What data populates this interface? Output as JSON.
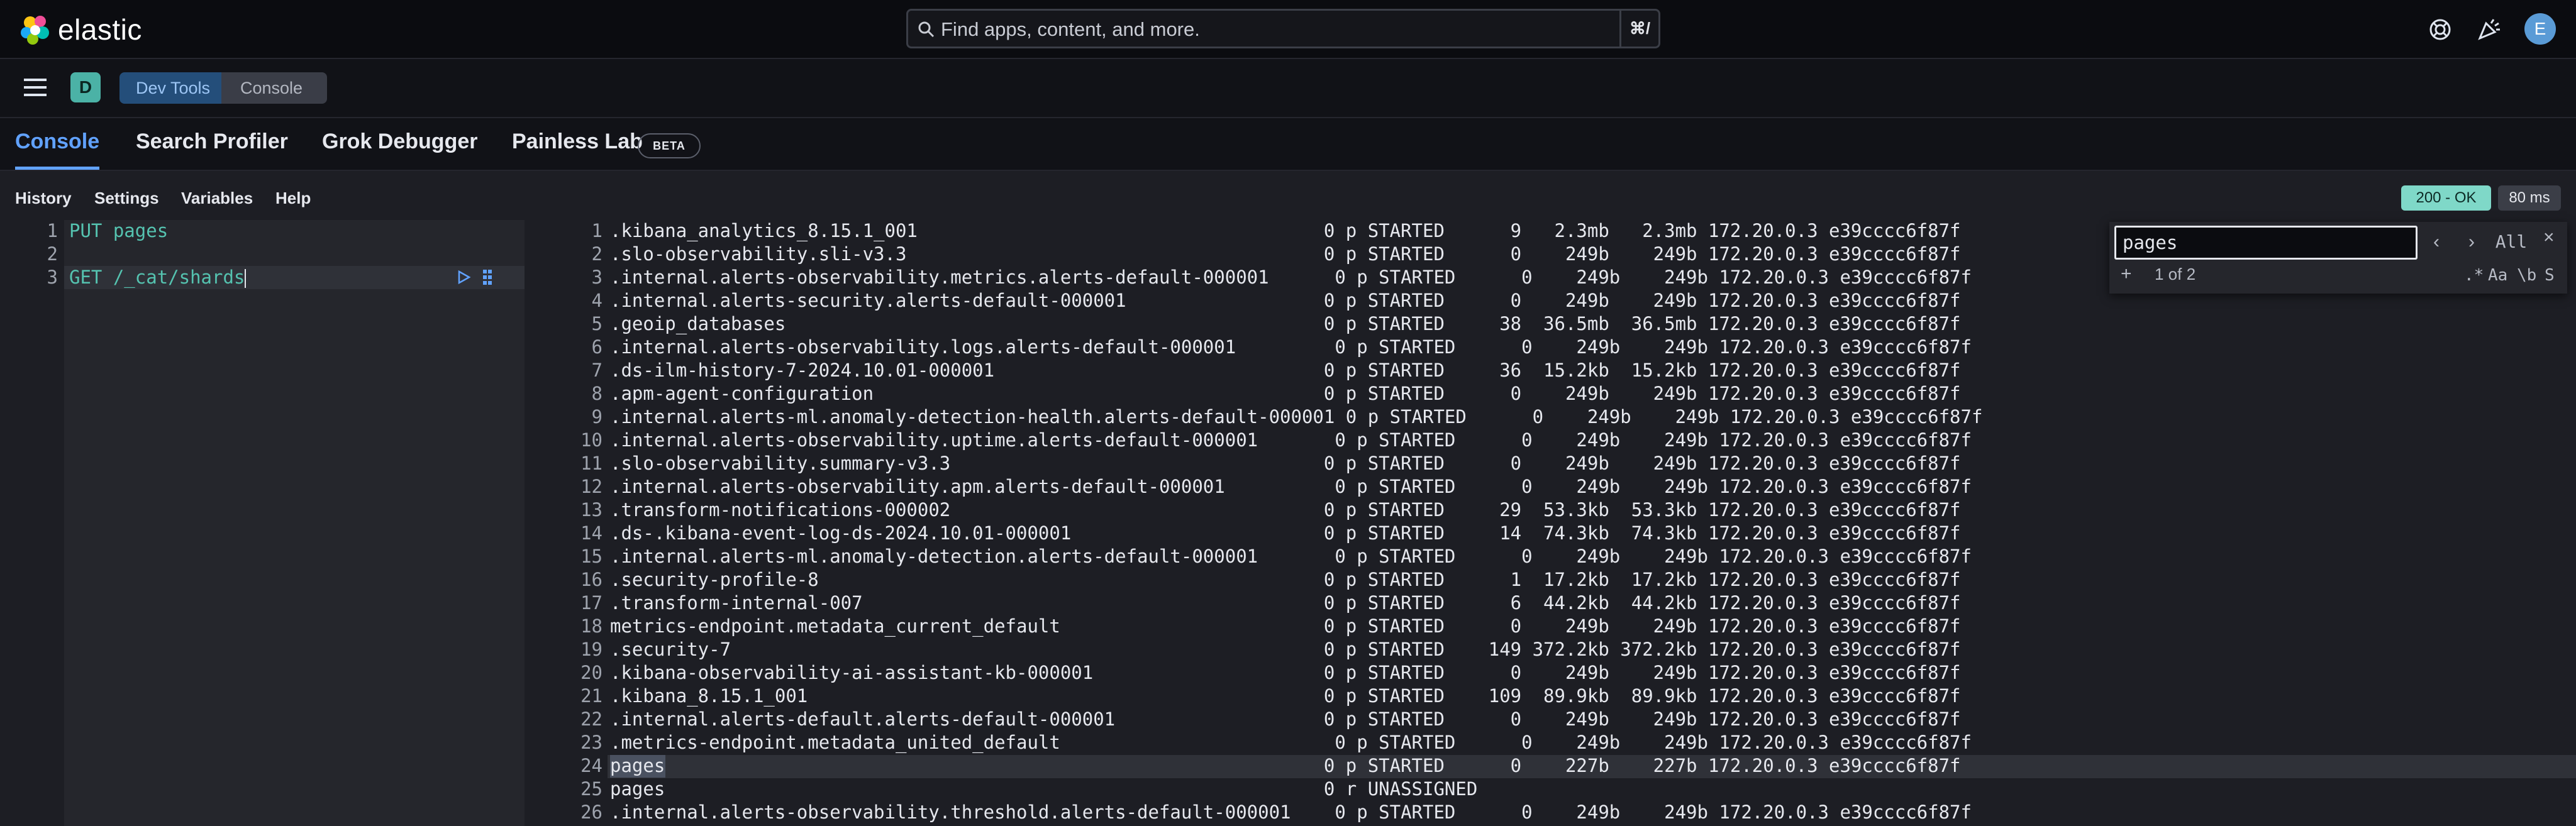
{
  "header": {
    "brand": "elastic",
    "search_placeholder": "Find apps, content, and more.",
    "search_shortcut": "⌘/",
    "avatar_initial": "E"
  },
  "breadcrumb": {
    "space_initial": "D",
    "items": [
      "Dev Tools",
      "Console"
    ]
  },
  "tabs": [
    {
      "label": "Console",
      "active": true
    },
    {
      "label": "Search Profiler"
    },
    {
      "label": "Grok Debugger"
    },
    {
      "label": "Painless Lab"
    }
  ],
  "beta_badge": "BETA",
  "toolbar": {
    "items": [
      "History",
      "Settings",
      "Variables",
      "Help"
    ],
    "status": "200 - OK",
    "time": "80 ms"
  },
  "request": {
    "lines": [
      {
        "n": "1",
        "method": "PUT",
        "text": " pages"
      },
      {
        "n": "2",
        "method": "",
        "text": ""
      },
      {
        "n": "3",
        "method": "GET",
        "text": " /_cat/shards"
      }
    ]
  },
  "response": {
    "highlighted_line": "24",
    "lines": [
      {
        "n": "1",
        "text": ".kibana_analytics_8.15.1_001                                     0 p STARTED      9   2.3mb   2.3mb 172.20.0.3 e39cccc6f87f"
      },
      {
        "n": "2",
        "text": ".slo-observability.sli-v3.3                                      0 p STARTED      0    249b    249b 172.20.0.3 e39cccc6f87f"
      },
      {
        "n": "3",
        "text": ".internal.alerts-observability.metrics.alerts-default-000001      0 p STARTED      0    249b    249b 172.20.0.3 e39cccc6f87f"
      },
      {
        "n": "4",
        "text": ".internal.alerts-security.alerts-default-000001                  0 p STARTED      0    249b    249b 172.20.0.3 e39cccc6f87f"
      },
      {
        "n": "5",
        "text": ".geoip_databases                                                 0 p STARTED     38  36.5mb  36.5mb 172.20.0.3 e39cccc6f87f"
      },
      {
        "n": "6",
        "text": ".internal.alerts-observability.logs.alerts-default-000001         0 p STARTED      0    249b    249b 172.20.0.3 e39cccc6f87f"
      },
      {
        "n": "7",
        "text": ".ds-ilm-history-7-2024.10.01-000001                              0 p STARTED     36  15.2kb  15.2kb 172.20.0.3 e39cccc6f87f"
      },
      {
        "n": "8",
        "text": ".apm-agent-configuration                                         0 p STARTED      0    249b    249b 172.20.0.3 e39cccc6f87f"
      },
      {
        "n": "9",
        "text": ".internal.alerts-ml.anomaly-detection-health.alerts-default-000001 0 p STARTED      0    249b    249b 172.20.0.3 e39cccc6f87f"
      },
      {
        "n": "10",
        "text": ".internal.alerts-observability.uptime.alerts-default-000001       0 p STARTED      0    249b    249b 172.20.0.3 e39cccc6f87f"
      },
      {
        "n": "11",
        "text": ".slo-observability.summary-v3.3                                  0 p STARTED      0    249b    249b 172.20.0.3 e39cccc6f87f"
      },
      {
        "n": "12",
        "text": ".internal.alerts-observability.apm.alerts-default-000001          0 p STARTED      0    249b    249b 172.20.0.3 e39cccc6f87f"
      },
      {
        "n": "13",
        "text": ".transform-notifications-000002                                  0 p STARTED     29  53.3kb  53.3kb 172.20.0.3 e39cccc6f87f"
      },
      {
        "n": "14",
        "text": ".ds-.kibana-event-log-ds-2024.10.01-000001                       0 p STARTED     14  74.3kb  74.3kb 172.20.0.3 e39cccc6f87f"
      },
      {
        "n": "15",
        "text": ".internal.alerts-ml.anomaly-detection.alerts-default-000001       0 p STARTED      0    249b    249b 172.20.0.3 e39cccc6f87f"
      },
      {
        "n": "16",
        "text": ".security-profile-8                                              0 p STARTED      1  17.2kb  17.2kb 172.20.0.3 e39cccc6f87f"
      },
      {
        "n": "17",
        "text": ".transform-internal-007                                          0 p STARTED      6  44.2kb  44.2kb 172.20.0.3 e39cccc6f87f"
      },
      {
        "n": "18",
        "text": "metrics-endpoint.metadata_current_default                        0 p STARTED      0    249b    249b 172.20.0.3 e39cccc6f87f"
      },
      {
        "n": "19",
        "text": ".security-7                                                      0 p STARTED    149 372.2kb 372.2kb 172.20.0.3 e39cccc6f87f"
      },
      {
        "n": "20",
        "text": ".kibana-observability-ai-assistant-kb-000001                     0 p STARTED      0    249b    249b 172.20.0.3 e39cccc6f87f"
      },
      {
        "n": "21",
        "text": ".kibana_8.15.1_001                                               0 p STARTED    109  89.9kb  89.9kb 172.20.0.3 e39cccc6f87f"
      },
      {
        "n": "22",
        "text": ".internal.alerts-default.alerts-default-000001                   0 p STARTED      0    249b    249b 172.20.0.3 e39cccc6f87f"
      },
      {
        "n": "23",
        "text": ".metrics-endpoint.metadata_united_default                         0 p STARTED      0    249b    249b 172.20.0.3 e39cccc6f87f"
      },
      {
        "n": "24",
        "text": "pages                                                            0 p STARTED      0    227b    227b 172.20.0.3 e39cccc6f87f"
      },
      {
        "n": "25",
        "text": "pages                                                            0 r UNASSIGNED"
      },
      {
        "n": "26",
        "text": ".internal.alerts-observability.threshold.alerts-default-000001    0 p STARTED      0    249b    249b 172.20.0.3 e39cccc6f87f"
      }
    ]
  },
  "find": {
    "value": "pages",
    "count": "1 of 2",
    "all_label": "All",
    "opt_regex": ".*",
    "opt_case": "Aa",
    "opt_word": "\\b",
    "opt_s": "S"
  },
  "colors": {
    "accent": "#61a2ff",
    "status_ok": "#7fd8c8",
    "space_badge": "#4bb2a6"
  }
}
